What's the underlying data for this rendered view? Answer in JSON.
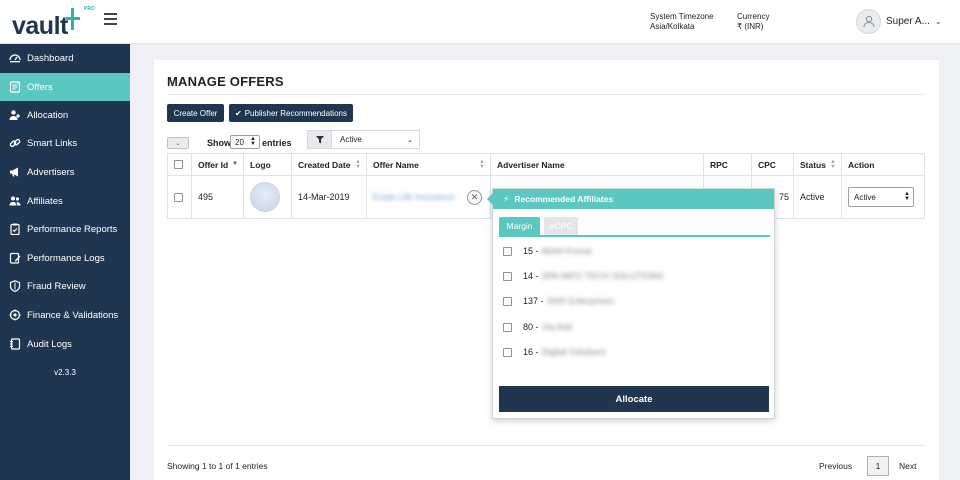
{
  "header": {
    "logo_text": "vault",
    "logo_badge": "PRO",
    "timezone_label": "System Timezone",
    "timezone_value": "Asia/Kolkata",
    "currency_label": "Currency",
    "currency_value": "₹ (INR)",
    "user_name": "Super A..."
  },
  "sidebar": {
    "items": [
      {
        "label": "Dashboard",
        "icon": "dashboard-icon"
      },
      {
        "label": "Offers",
        "icon": "offers-icon",
        "active": true
      },
      {
        "label": "Allocation",
        "icon": "allocation-icon"
      },
      {
        "label": "Smart Links",
        "icon": "link-icon"
      },
      {
        "label": "Advertisers",
        "icon": "megaphone-icon"
      },
      {
        "label": "Affiliates",
        "icon": "users-icon"
      },
      {
        "label": "Performance Reports",
        "icon": "report-icon"
      },
      {
        "label": "Performance Logs",
        "icon": "logs-icon"
      },
      {
        "label": "Fraud Review",
        "icon": "shield-icon"
      },
      {
        "label": "Finance & Validations",
        "icon": "finance-icon"
      },
      {
        "label": "Audit Logs",
        "icon": "audit-icon"
      }
    ],
    "version": "v2.3.3"
  },
  "page": {
    "title": "MANAGE OFFERS",
    "create_offer": "Create Offer",
    "publisher_recommendations": "Publisher Recommendations",
    "show_label": "Show",
    "show_value": "20",
    "entries_label": "entries",
    "filter_value": "Active"
  },
  "table": {
    "headers": [
      "Offer Id",
      "Logo",
      "Created Date",
      "Offer Name",
      "Advertiser Name",
      "RPC",
      "CPC",
      "Status",
      "Action"
    ],
    "row": {
      "offer_id": "495",
      "created_date": "14-Mar-2019",
      "offer_name": "Exide Life Insurance",
      "cpc_partial": "75",
      "status": "Active",
      "action_value": "Active"
    }
  },
  "footer": {
    "showing": "Showing 1 to 1 of 1 entries",
    "previous": "Previous",
    "page": "1",
    "next": "Next"
  },
  "popover": {
    "title": "Recommended Affiliates",
    "tabs": [
      "Margin",
      "eCPC"
    ],
    "affiliates": [
      {
        "id": "15",
        "name": "Mohit Kumar"
      },
      {
        "id": "14",
        "name": "SPA INFO TECH SOLUTIONS"
      },
      {
        "id": "137",
        "name": "XMS Enterprises"
      },
      {
        "id": "80",
        "name": "Via Add"
      },
      {
        "id": "16",
        "name": "Digital Solutions"
      }
    ],
    "allocate": "Allocate"
  }
}
